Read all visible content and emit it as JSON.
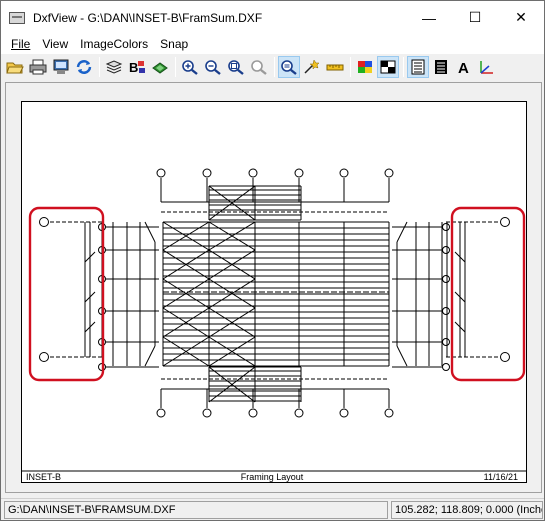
{
  "window": {
    "title": "DxfView - G:\\DAN\\INSET-B\\FramSum.DXF",
    "min_glyph": "—",
    "max_glyph": "☐",
    "close_glyph": "✕"
  },
  "menu": {
    "file": "File",
    "view": "View",
    "image_colors": "ImageColors",
    "snap": "Snap"
  },
  "toolbar": {
    "icons": [
      "open-icon",
      "print-icon",
      "print-preview-icon",
      "refresh-icon",
      "layers-icon",
      "block-icon",
      "color-icon",
      "zoom-in-icon",
      "zoom-out-icon",
      "zoom-window-icon",
      "zoom-previous-icon",
      "zoom-extents-icon",
      "measure-icon",
      "ruler-icon",
      "color-palette-icon",
      "background-icon",
      "list-icon",
      "entities-icon",
      "text-icon",
      "axis-icon"
    ]
  },
  "drawing": {
    "left_label": "INSET-B",
    "center_label": "Framing Layout",
    "right_label": "11/16/21",
    "highlight_color": "#d01020"
  },
  "status": {
    "path": "G:\\DAN\\INSET-B\\FRAMSUM.DXF",
    "coords": "105.282; 118.809; 0.000 (Inches)"
  }
}
